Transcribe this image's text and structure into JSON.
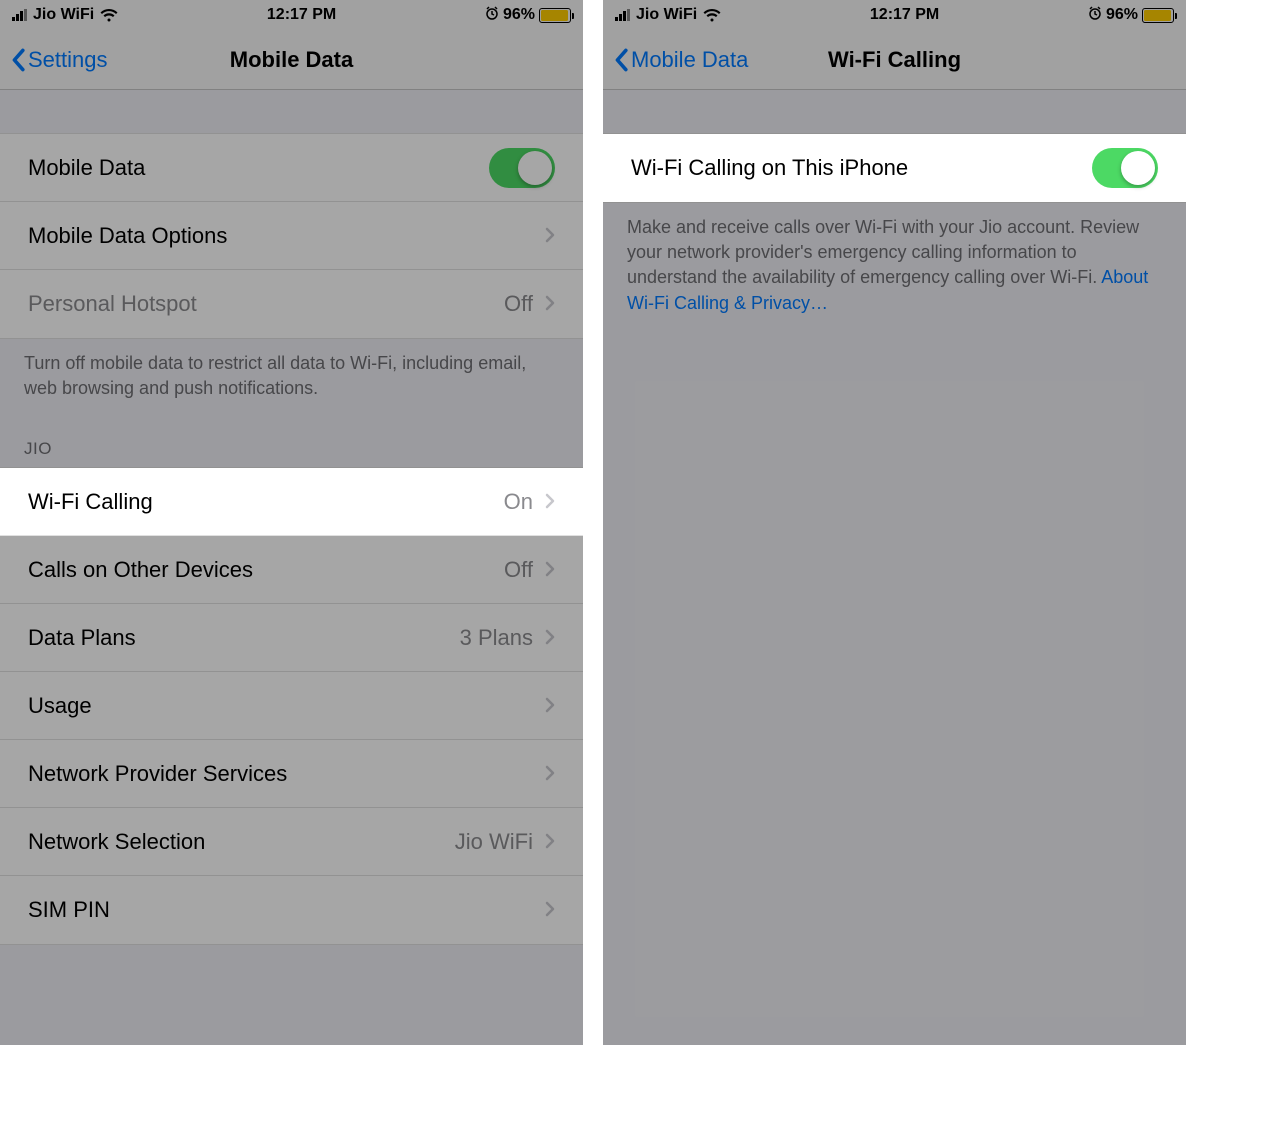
{
  "status": {
    "carrier": "Jio WiFi",
    "time": "12:17 PM",
    "battery_pct": "96%",
    "battery_fill": 96
  },
  "left": {
    "back_label": "Settings",
    "title": "Mobile Data",
    "rows": {
      "mobile_data": "Mobile Data",
      "mobile_data_options": "Mobile Data Options",
      "personal_hotspot": "Personal Hotspot",
      "personal_hotspot_val": "Off"
    },
    "footer1": "Turn off mobile data to restrict all data to Wi-Fi, including email, web browsing and push notifications.",
    "section_header": "JIO",
    "jio": {
      "wifi_calling": "Wi-Fi Calling",
      "wifi_calling_val": "On",
      "calls_other": "Calls on Other Devices",
      "calls_other_val": "Off",
      "data_plans": "Data Plans",
      "data_plans_val": "3 Plans",
      "usage": "Usage",
      "provider_services": "Network Provider Services",
      "network_selection": "Network Selection",
      "network_selection_val": "Jio WiFi",
      "sim_pin": "SIM PIN"
    }
  },
  "right": {
    "back_label": "Mobile Data",
    "title": "Wi-Fi Calling",
    "row_label": "Wi-Fi Calling on This iPhone",
    "footer_text": "Make and receive calls over Wi-Fi with your Jio account. Review your network provider's emergency calling information to understand the availability of emergency calling over Wi-Fi. ",
    "footer_link": "About Wi-Fi Calling & Privacy…"
  }
}
